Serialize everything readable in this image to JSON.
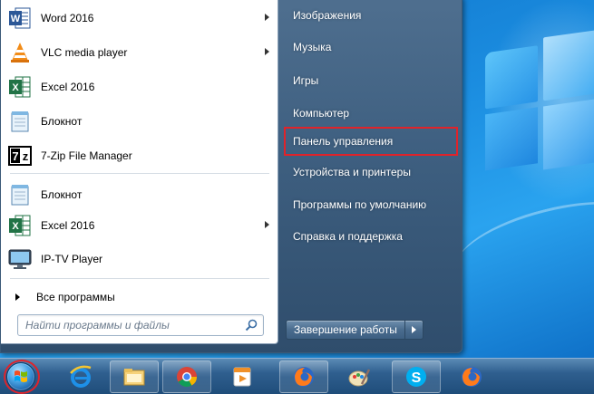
{
  "start_menu": {
    "programs": [
      {
        "label": "Word 2016",
        "icon": "word-icon",
        "has_submenu": true
      },
      {
        "label": "VLC media player",
        "icon": "vlc-icon",
        "has_submenu": true
      },
      {
        "label": "Excel 2016",
        "icon": "excel-icon",
        "has_submenu": false
      },
      {
        "label": "Блокнот",
        "icon": "notepad-icon",
        "has_submenu": false
      },
      {
        "label": "7-Zip File Manager",
        "icon": "7zip-icon",
        "has_submenu": false
      },
      {
        "label": "Блокнот",
        "icon": "notepad-icon",
        "has_submenu": false
      },
      {
        "label": "Excel 2016",
        "icon": "excel-icon",
        "has_submenu": true
      },
      {
        "label": "IP-TV Player",
        "icon": "iptv-icon",
        "has_submenu": false
      }
    ],
    "all_programs_label": "Все программы",
    "search_placeholder": "Найти программы и файлы",
    "right_items": [
      {
        "label": "Изображения"
      },
      {
        "label": "Музыка"
      },
      {
        "label": "Игры"
      },
      {
        "label": "Компьютер"
      },
      {
        "label": "Панель управления",
        "highlighted": true
      },
      {
        "label": "Устройства и принтеры"
      },
      {
        "label": "Программы по умолчанию"
      },
      {
        "label": "Справка и поддержка"
      }
    ],
    "shutdown_label": "Завершение работы"
  },
  "taskbar": {
    "start_button": "windows-start-orb-icon",
    "items": [
      {
        "icon": "internet-explorer-icon"
      },
      {
        "icon": "file-explorer-icon"
      },
      {
        "icon": "chrome-icon"
      },
      {
        "icon": "media-player-icon"
      },
      {
        "icon": "firefox-icon"
      },
      {
        "icon": "paint-icon"
      },
      {
        "icon": "skype-icon"
      },
      {
        "icon": "firefox-icon"
      }
    ]
  },
  "colors": {
    "highlight_outline": "#e0232a",
    "menu_right_bg": "#3e5f80",
    "taskbar_bg": "#2f5f8f"
  }
}
